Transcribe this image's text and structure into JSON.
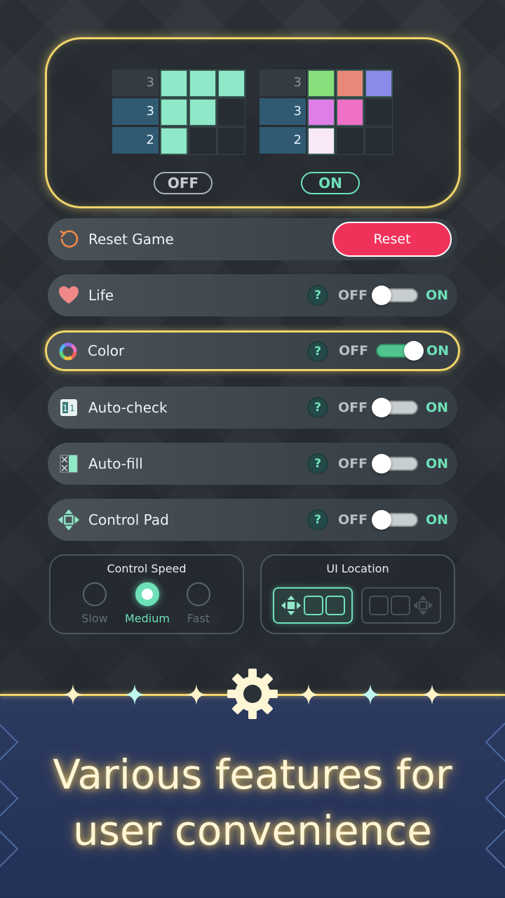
{
  "preview": {
    "left_grid": {
      "clues": [
        "3",
        "3",
        "2"
      ],
      "rows": [
        [
          "#8fe8c8",
          "#8fe8c8",
          "#8fe8c8"
        ],
        [
          "#8fe8c8",
          "#8fe8c8",
          null
        ],
        [
          "#8fe8c8",
          null,
          null
        ]
      ]
    },
    "right_grid": {
      "clues": [
        "3",
        "3",
        "2"
      ],
      "rows": [
        [
          "#86e07c",
          "#e88878",
          "#8a8ae8"
        ],
        [
          "#e07ee8",
          "#f070c8",
          null
        ],
        [
          "#f8e8f8",
          null,
          null
        ]
      ]
    },
    "off_label": "OFF",
    "on_label": "ON"
  },
  "reset": {
    "label": "Reset Game",
    "button": "Reset"
  },
  "settings": [
    {
      "label": "Life",
      "icon": "heart-icon",
      "off": "OFF",
      "on": "ON",
      "help": "?",
      "enabled": false
    },
    {
      "label": "Color",
      "icon": "color-wheel-icon",
      "off": "OFF",
      "on": "ON",
      "help": "?",
      "enabled": true
    },
    {
      "label": "Auto-check",
      "icon": "auto-check-icon",
      "off": "OFF",
      "on": "ON",
      "help": "?",
      "enabled": false
    },
    {
      "label": "Auto-fill",
      "icon": "auto-fill-icon",
      "off": "OFF",
      "on": "ON",
      "help": "?",
      "enabled": false
    },
    {
      "label": "Control Pad",
      "icon": "control-pad-icon",
      "off": "OFF",
      "on": "ON",
      "help": "?",
      "enabled": false
    }
  ],
  "control_speed": {
    "title": "Control Speed",
    "options": [
      "Slow",
      "Medium",
      "Fast"
    ],
    "selected": "Medium"
  },
  "ui_location": {
    "title": "UI Location",
    "selected_index": 0
  },
  "footer": {
    "line1": "Various features for",
    "line2": "user convenience"
  },
  "colors": {
    "accent": "#6ee0b8",
    "gold": "#f0d46a",
    "reset": "#f0325a"
  }
}
